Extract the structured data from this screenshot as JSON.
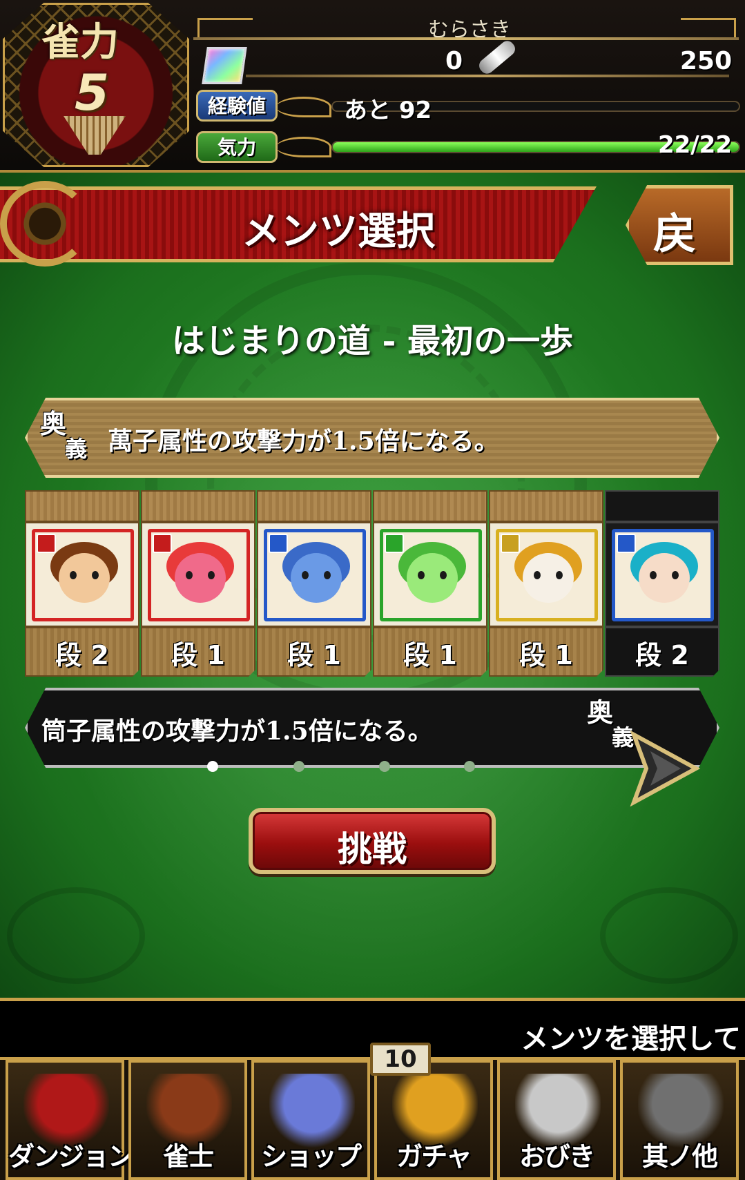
{
  "header": {
    "rank_label": "雀力",
    "rank_value": "5",
    "player_name": "むらさき",
    "gems_current": "0",
    "gems_max": "250",
    "exp_label": "経験値",
    "exp_text": "あと 92",
    "stamina_label": "気力",
    "stamina_text": "22/22",
    "stamina_fraction": 1.0
  },
  "screen": {
    "title": "メンツ選択",
    "back_label": "戻",
    "stage_title": "はじまりの道 - 最初の一歩"
  },
  "skills": {
    "ougi_label": "奥義",
    "top_text": "萬子属性の攻撃力が1.5倍になる。",
    "bottom_text": "筒子属性の攻撃力が1.5倍になる。"
  },
  "cards": [
    {
      "rank": "段 2",
      "frame_color": "#d42424",
      "face_color": "#f2c89a",
      "hair_color": "#7a3a12",
      "badge_color": "#c41c1c",
      "selected": false
    },
    {
      "rank": "段 1",
      "frame_color": "#d42424",
      "face_color": "#f06a8a",
      "hair_color": "#e83a3a",
      "badge_color": "#c41c1c",
      "selected": false
    },
    {
      "rank": "段 1",
      "frame_color": "#2458c8",
      "face_color": "#6a9ae6",
      "hair_color": "#3a6ac8",
      "badge_color": "#2458c8",
      "selected": false
    },
    {
      "rank": "段 1",
      "frame_color": "#2aa42a",
      "face_color": "#9aea7a",
      "hair_color": "#4ab83a",
      "badge_color": "#2aa42a",
      "selected": false
    },
    {
      "rank": "段 1",
      "frame_color": "#d8b020",
      "face_color": "#f6f0e6",
      "hair_color": "#e0a020",
      "badge_color": "#c8a020",
      "selected": false
    },
    {
      "rank": "段 2",
      "frame_color": "#2458c8",
      "face_color": "#f6dcc8",
      "hair_color": "#1ab0c8",
      "badge_color": "#2458c8",
      "selected": true
    }
  ],
  "pager": {
    "count": 4,
    "active": 0
  },
  "challenge_label": "挑戦",
  "ticker_text": "メンツを選択して",
  "nav": {
    "items": [
      {
        "label": "ダンジョン",
        "icon": "dungeon-gate-icon",
        "color": "#b01818"
      },
      {
        "label": "雀士",
        "icon": "warrior-icon",
        "color": "#8a3a18"
      },
      {
        "label": "ショップ",
        "icon": "shop-card-icon",
        "color": "#6a7ad8"
      },
      {
        "label": "ガチャ",
        "icon": "gacha-creature-icon",
        "color": "#e0a020"
      },
      {
        "label": "おびき",
        "icon": "lure-icon",
        "color": "#c8c8c8"
      },
      {
        "label": "其ノ他",
        "icon": "gear-icon",
        "color": "#707070"
      }
    ],
    "gacha_badge": "10"
  }
}
